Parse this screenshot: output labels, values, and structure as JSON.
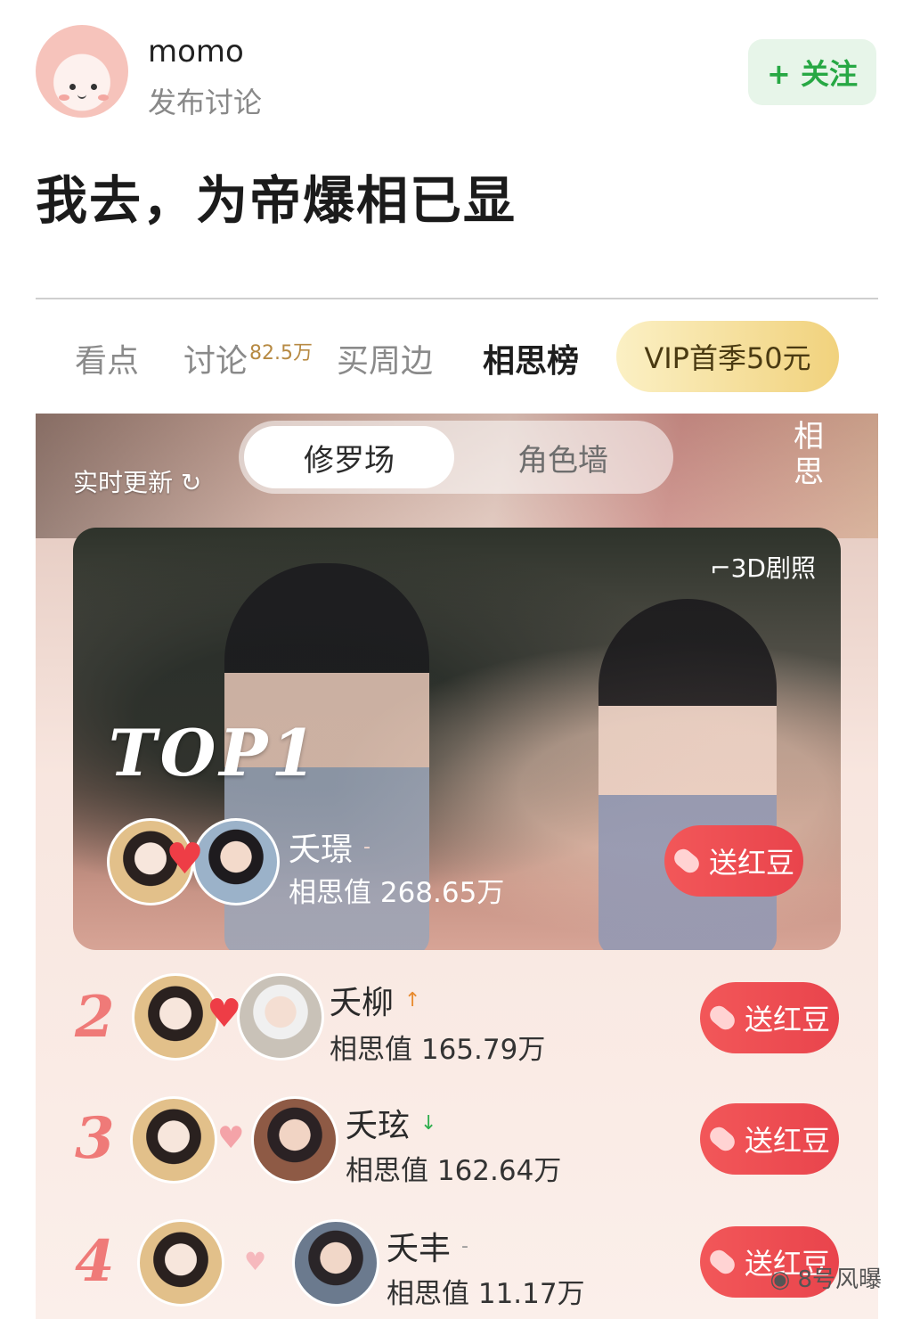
{
  "post": {
    "username": "momo",
    "subtitle": "发布讨论",
    "follow_label": "+ 关注",
    "title": "我去，为帝爆相已显"
  },
  "tabs": [
    {
      "label": "看点"
    },
    {
      "label": "讨论",
      "badge": "82.5万"
    },
    {
      "label": "买周边"
    },
    {
      "label": "相思榜",
      "active": true
    }
  ],
  "vip_label": "VIP首季50元",
  "ranking": {
    "realtime_label": "实时更新",
    "segments": [
      "修罗场",
      "角色墙"
    ],
    "seal_text": "相思",
    "photo_tag": "3D剧照",
    "top1_label": "TOP1",
    "gift_label": "送红豆",
    "items": [
      {
        "rank": "1",
        "name": "夭璟",
        "trend": "-",
        "score": "相思值 268.65万"
      },
      {
        "rank": "2",
        "name": "夭柳",
        "trend": "↑",
        "score": "相思值 165.79万"
      },
      {
        "rank": "3",
        "name": "夭玹",
        "trend": "↓",
        "score": "相思值 162.64万"
      },
      {
        "rank": "4",
        "name": "夭丰",
        "trend": "-",
        "score": "相思值 11.17万"
      }
    ]
  },
  "watermark": "8号风曝",
  "colors": {
    "follow_green": "#27a844",
    "gift_red": "#ef4a50",
    "rank_pink": "#ef7a78",
    "vip_gold": "#f1d27d"
  }
}
